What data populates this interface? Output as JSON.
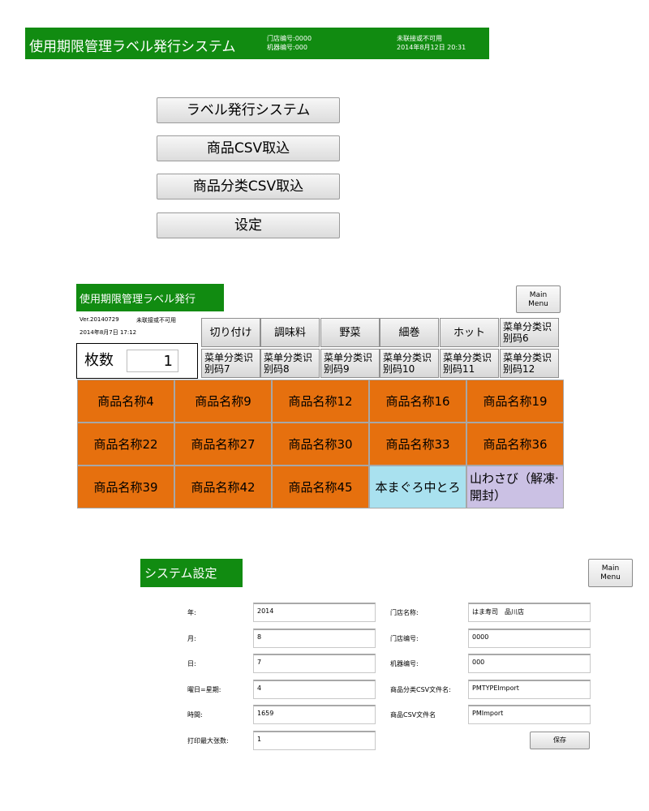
{
  "top": {
    "title": "使用期限管理ラベル発行システム",
    "store_no": "门店编号:0000",
    "machine_no": "机器编号:000",
    "connection": "未联接或不可用",
    "datetime": "2014年8月12日 20:31",
    "menu": [
      "ラベル発行システム",
      "商品CSV取込",
      "商品分类CSV取込",
      "设定"
    ]
  },
  "issue": {
    "title": "使用期限管理ラベル発行",
    "main_menu": [
      "Main",
      "Menu"
    ],
    "version": "Ver.20140729",
    "connection": "未联接或不可用",
    "date": "2014年8月7日 17:12",
    "count_label": "枚数",
    "count_value": "1",
    "categories_row1": [
      "切り付け",
      "調味料",
      "野菜",
      "細巻",
      "ホット",
      [
        "菜单分类识",
        "别码6"
      ]
    ],
    "categories_row2": [
      [
        "菜单分类识",
        "别码7"
      ],
      [
        "菜单分类识",
        "别码8"
      ],
      [
        "菜单分类识",
        "别码9"
      ],
      [
        "菜单分类识",
        "别码10"
      ],
      [
        "菜单分类识",
        "别码11"
      ],
      [
        "菜单分类识",
        "别码12"
      ]
    ],
    "products": [
      "商品名称4",
      "商品名称9",
      "商品名称12",
      "商品名称16",
      "商品名称19",
      "商品名称22",
      "商品名称27",
      "商品名称30",
      "商品名称33",
      "商品名称36",
      "商品名称39",
      "商品名称42",
      "商品名称45",
      "本まぐろ中とろ",
      "山わさび（解凍·開封）"
    ],
    "colors": {
      "orange": "#e6700e",
      "cyan": "#a9e1ef",
      "lavender": "#cbc1e4",
      "header_green": "#118b11"
    }
  },
  "settings": {
    "title": "システム設定",
    "main_menu": [
      "Main",
      "Menu"
    ],
    "left": [
      {
        "label": "年:",
        "value": "2014"
      },
      {
        "label": "月:",
        "value": "8"
      },
      {
        "label": "日:",
        "value": "7"
      },
      {
        "label": "曜日=星期:",
        "value": "4"
      },
      {
        "label": "時間:",
        "value": "1659"
      },
      {
        "label": "打印最大张数:",
        "value": "1"
      }
    ],
    "right": [
      {
        "label": "门店名称:",
        "value": "はま寿司　品川店"
      },
      {
        "label": "门店编号:",
        "value": "0000"
      },
      {
        "label": "机器编号:",
        "value": "000"
      },
      {
        "label": "商品分类CSV文件名:",
        "value": "PMTYPEImport"
      },
      {
        "label": "商品CSV文件名",
        "value": "PMImport"
      }
    ],
    "save_label": "保存"
  }
}
